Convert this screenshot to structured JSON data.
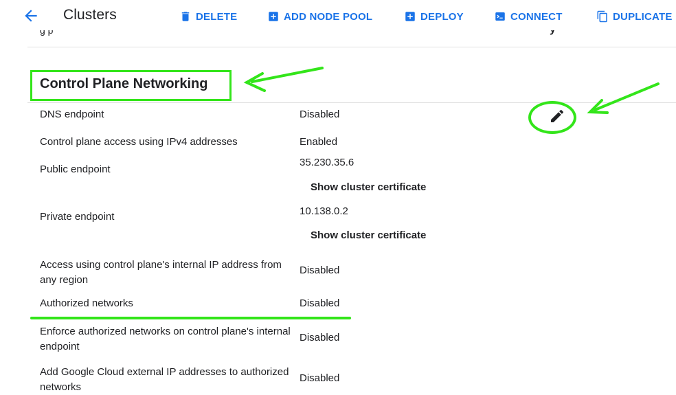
{
  "toolbar": {
    "title": "Clusters",
    "buttons": [
      {
        "label": "DELETE",
        "icon": "trash-icon"
      },
      {
        "label": "ADD NODE POOL",
        "icon": "add-box-icon"
      },
      {
        "label": "DEPLOY",
        "icon": "add-box-icon"
      },
      {
        "label": "CONNECT",
        "icon": "terminal-icon"
      },
      {
        "label": "DUPLICATE",
        "icon": "copy-icon"
      }
    ]
  },
  "cut_row": {
    "left": "g p",
    "right": "y"
  },
  "section": {
    "title": "Control Plane Networking",
    "rows": [
      {
        "label": "DNS endpoint",
        "value": "Disabled"
      },
      {
        "label": "Control plane access using IPv4 addresses",
        "value": "Enabled"
      },
      {
        "label": "Public endpoint",
        "value": "35.230.35.6",
        "link": "Show cluster certificate"
      },
      {
        "label": "Private endpoint",
        "value": "10.138.0.2",
        "link": "Show cluster certificate"
      },
      {
        "label": "Access using control plane's internal IP address from any region",
        "value": "Disabled"
      },
      {
        "label": "Authorized networks",
        "value": "Disabled"
      },
      {
        "label": "Enforce authorized networks on control plane's internal endpoint",
        "value": "Disabled"
      },
      {
        "label": "Add Google Cloud external IP addresses to authorized networks",
        "value": "Disabled"
      }
    ]
  },
  "colors": {
    "accent": "#1a73e8",
    "annotation": "#33e51a",
    "text": "#202124",
    "divider": "#e0e0e0"
  }
}
